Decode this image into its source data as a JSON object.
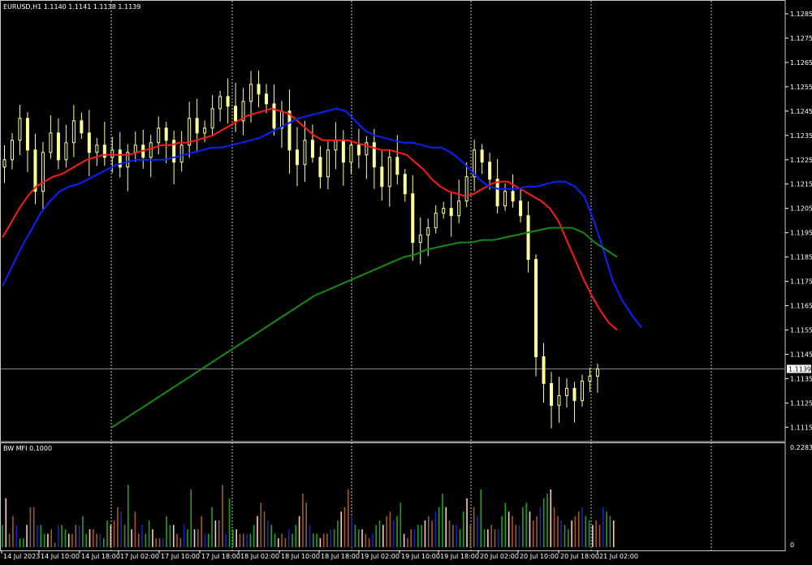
{
  "window": {
    "main_title": "EURUSD,H1  1.1140 1.1141 1.1138 1.1139",
    "sub_title": "BW MFI 0.1000",
    "current_price_label": "1.1139"
  },
  "colors": {
    "background": "#000000",
    "candle": "#ffff99",
    "ma_red": "#ff1a1a",
    "ma_blue": "#0a22ff",
    "ma_green": "#138a13",
    "grid": "#c8c8c8",
    "separator": "#c8c8c8",
    "mfi_green": "#22a022",
    "mfi_blue": "#1d22b8",
    "mfi_brown": "#a05a2c",
    "mfi_pink": "#ffc8c8",
    "text": "#ffffff"
  },
  "chart_data": [
    {
      "type": "candlestick",
      "symbol": "EURUSD",
      "timeframe": "H1",
      "title": "EURUSD,H1  1.1140 1.1141 1.1138 1.1139",
      "ylim": [
        1.111,
        1.129
      ],
      "y_ticks": [
        "1.1285",
        "1.1275",
        "1.1265",
        "1.1255",
        "1.1245",
        "1.1235",
        "1.1225",
        "1.1215",
        "1.1205",
        "1.1195",
        "1.1185",
        "1.1175",
        "1.1165",
        "1.1155",
        "1.1145",
        "1.1135",
        "1.1125",
        "1.1115"
      ],
      "x_ticks": [
        "14 Jul 2023",
        "14 Jul 10:00",
        "14 Jul 18:00",
        "17 Jul 02:00",
        "17 Jul 10:00",
        "17 Jul 18:00",
        "18 Jul 02:00",
        "18 Jul 10:00",
        "18 Jul 18:00",
        "19 Jul 02:00",
        "19 Jul 10:00",
        "19 Jul 18:00",
        "20 Jul 02:00",
        "20 Jul 10:00",
        "20 Jul 18:00",
        "21 Jul 02:00"
      ],
      "current_price": 1.1139,
      "candle_path": [
        1.1225,
        1.1233,
        1.1242,
        1.1229,
        1.1212,
        1.1228,
        1.1236,
        1.1225,
        1.1232,
        1.1241,
        1.1236,
        1.1228,
        1.1231,
        1.1226,
        1.1229,
        1.1222,
        1.1228,
        1.1231,
        1.1226,
        1.1232,
        1.1238,
        1.1233,
        1.1224,
        1.1231,
        1.1242,
        1.1236,
        1.1238,
        1.1246,
        1.1251,
        1.1247,
        1.1241,
        1.1249,
        1.1256,
        1.1252,
        1.1248,
        1.1238,
        1.1245,
        1.1229,
        1.1223,
        1.1233,
        1.1226,
        1.1218,
        1.1229,
        1.1233,
        1.1224,
        1.1231,
        1.1227,
        1.1232,
        1.1222,
        1.1214,
        1.1226,
        1.1219,
        1.1211,
        1.1191,
        1.1194,
        1.1197,
        1.1203,
        1.1205,
        1.1202,
        1.1208,
        1.1218,
        1.1229,
        1.1224,
        1.1217,
        1.1206,
        1.1212,
        1.1208,
        1.1202,
        1.1184,
        1.1144,
        1.1133,
        1.1124,
        1.1128,
        1.1131,
        1.1126,
        1.1134,
        1.1136,
        1.1139
      ],
      "ma_red": [
        1.1193,
        1.1199,
        1.1205,
        1.121,
        1.1214,
        1.1216,
        1.1218,
        1.1219,
        1.1221,
        1.1223,
        1.1225,
        1.1226,
        1.1227,
        1.1227,
        1.1227,
        1.1227,
        1.1228,
        1.1229,
        1.123,
        1.1231,
        1.1231,
        1.1232,
        1.1232,
        1.1233,
        1.1234,
        1.1235,
        1.1237,
        1.1239,
        1.1241,
        1.1243,
        1.1244,
        1.1245,
        1.1246,
        1.1245,
        1.1244,
        1.1241,
        1.1238,
        1.1235,
        1.1233,
        1.1233,
        1.1233,
        1.1233,
        1.1232,
        1.1231,
        1.123,
        1.1229,
        1.1229,
        1.1228,
        1.1227,
        1.1224,
        1.1221,
        1.1217,
        1.1214,
        1.1212,
        1.1211,
        1.121,
        1.1211,
        1.1213,
        1.1215,
        1.1216,
        1.1216,
        1.1214,
        1.1212,
        1.121,
        1.1208,
        1.1205,
        1.12,
        1.1192,
        1.1184,
        1.1176,
        1.1169,
        1.1163,
        1.1158,
        1.1155
      ],
      "ma_blue": [
        1.1173,
        1.1181,
        1.1189,
        1.1196,
        1.1203,
        1.1208,
        1.1212,
        1.1214,
        1.1215,
        1.1217,
        1.1219,
        1.1221,
        1.1223,
        1.1224,
        1.1225,
        1.1225,
        1.1225,
        1.1225,
        1.1226,
        1.1227,
        1.1228,
        1.1229,
        1.123,
        1.123,
        1.1231,
        1.1232,
        1.1233,
        1.1234,
        1.1236,
        1.1238,
        1.124,
        1.1242,
        1.1243,
        1.1244,
        1.1245,
        1.1246,
        1.1245,
        1.1241,
        1.1237,
        1.1235,
        1.1234,
        1.1233,
        1.1232,
        1.1232,
        1.1231,
        1.123,
        1.123,
        1.1228,
        1.1225,
        1.1221,
        1.1217,
        1.1214,
        1.1213,
        1.1213,
        1.1213,
        1.1214,
        1.1214,
        1.1215,
        1.1216,
        1.1216,
        1.1214,
        1.121,
        1.12,
        1.1188,
        1.1175,
        1.1167,
        1.1161,
        1.1156
      ],
      "ma_green": [
        1.1115,
        1.1118,
        1.1121,
        1.1124,
        1.1127,
        1.113,
        1.1133,
        1.1136,
        1.1139,
        1.1142,
        1.1145,
        1.1148,
        1.1151,
        1.1154,
        1.1157,
        1.116,
        1.1163,
        1.1166,
        1.1169,
        1.1171,
        1.1173,
        1.1175,
        1.1177,
        1.1179,
        1.1181,
        1.1183,
        1.1185,
        1.1186,
        1.1188,
        1.1189,
        1.119,
        1.1191,
        1.1191,
        1.1192,
        1.1192,
        1.1193,
        1.1194,
        1.1195,
        1.1196,
        1.1197,
        1.1197,
        1.1197,
        1.1195,
        1.1191,
        1.1188,
        1.1185
      ]
    },
    {
      "type": "bar",
      "title": "BW MFI 0.1000",
      "ylim": [
        0,
        0.2283
      ],
      "y_ticks": [
        "0.2283",
        "0"
      ],
      "values": [
        0.05,
        0.11,
        0.03,
        0.07,
        0.05,
        0.02,
        0.02,
        0.05,
        0.09,
        0.09,
        0.05,
        0.05,
        0.03,
        0.03,
        0.04,
        0.01,
        0.05,
        0.05,
        0.04,
        0.03,
        0.03,
        0.05,
        0.05,
        0.07,
        0.03,
        0.04,
        0.04,
        0.03,
        0.03,
        0.02,
        0.06,
        0.05,
        0.06,
        0.09,
        0.08,
        0.05,
        0.14,
        0.04,
        0.08,
        0.03,
        0.05,
        0.03,
        0.06,
        0.04,
        0.02,
        0.02,
        0.02,
        0.07,
        0.05,
        0.05,
        0.03,
        0.02,
        0.05,
        0.04,
        0.13,
        0.04,
        0.04,
        0.07,
        0.03,
        0.03,
        0.09,
        0.06,
        0.06,
        0.14,
        0.03,
        0.11,
        0.04,
        0.04,
        0.03,
        0.03,
        0.03,
        0.03,
        0.05,
        0.07,
        0.1,
        0.08,
        0.06,
        0.05,
        0.03,
        0.02,
        0.03,
        0.02,
        0.04,
        0.03,
        0.05,
        0.07,
        0.12,
        0.1,
        0.05,
        0.03,
        0.03,
        0.02,
        0.03,
        0.03,
        0.04,
        0.04,
        0.06,
        0.08,
        0.09,
        0.13,
        0.07,
        0.05,
        0.04,
        0.04,
        0.03,
        0.02,
        0.03,
        0.05,
        0.06,
        0.05,
        0.07,
        0.08,
        0.06,
        0.07,
        0.1,
        0.03,
        0.02,
        0.04,
        0.04,
        0.05,
        0.05,
        0.06,
        0.07,
        0.06,
        0.08,
        0.09,
        0.12,
        0.09,
        0.06,
        0.05,
        0.05,
        0.04,
        0.08,
        0.11,
        0.05,
        0.09,
        0.07,
        0.13,
        0.04,
        0.04,
        0.05,
        0.04,
        0.04,
        0.07,
        0.1,
        0.08,
        0.07,
        0.05,
        0.05,
        0.09,
        0.1,
        0.08,
        0.06,
        0.07,
        0.09,
        0.11,
        0.12,
        0.13,
        0.09,
        0.07,
        0.06,
        0.05,
        0.04,
        0.06,
        0.07,
        0.08,
        0.09,
        0.07,
        0.06,
        0.05,
        0.06,
        0.05,
        0.09,
        0.08,
        0.07,
        0.06
      ],
      "colors_cycle": [
        "green",
        "blue",
        "brown",
        "pink"
      ]
    }
  ]
}
